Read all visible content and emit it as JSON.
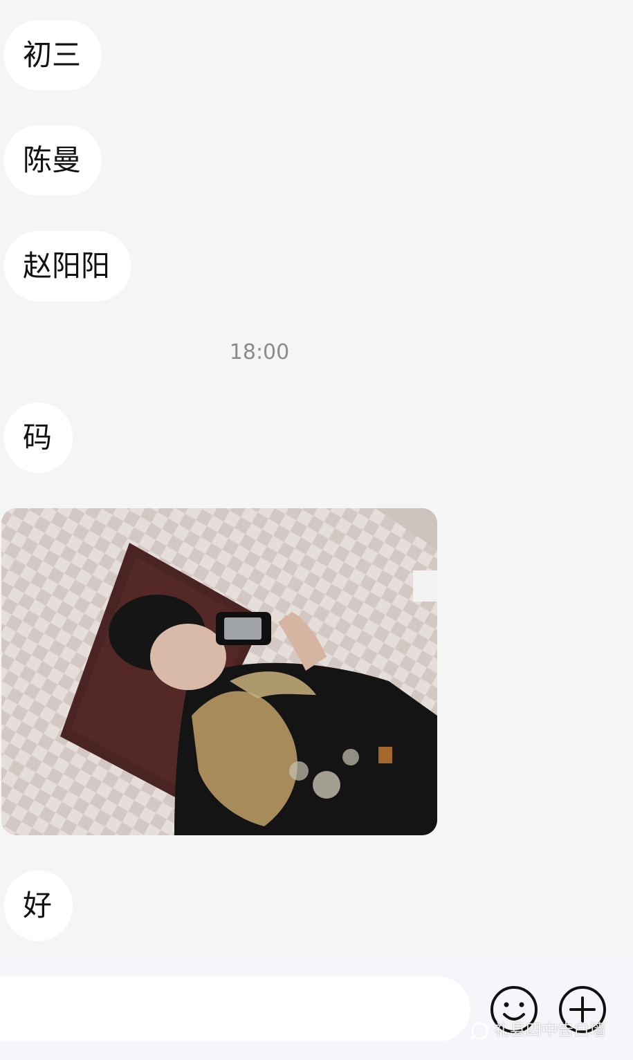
{
  "messages": [
    {
      "text": "初三"
    },
    {
      "text": "陈曼"
    },
    {
      "text": "赵阳阳"
    },
    {
      "text": "码"
    },
    {
      "text": "好"
    }
  ],
  "timestamp": "18:00",
  "image_message": {
    "description_icon": "photo-thumbnail"
  },
  "composer": {
    "input_value": "",
    "emoji_icon": "smiley-icon",
    "plus_icon": "plus-icon"
  },
  "watermark": {
    "text": "礼县四中告白墙"
  },
  "colors": {
    "background": "#f5f5f5",
    "bubble": "#ffffff",
    "timestamp": "#8c8c8c",
    "icon_stroke": "#111111"
  }
}
